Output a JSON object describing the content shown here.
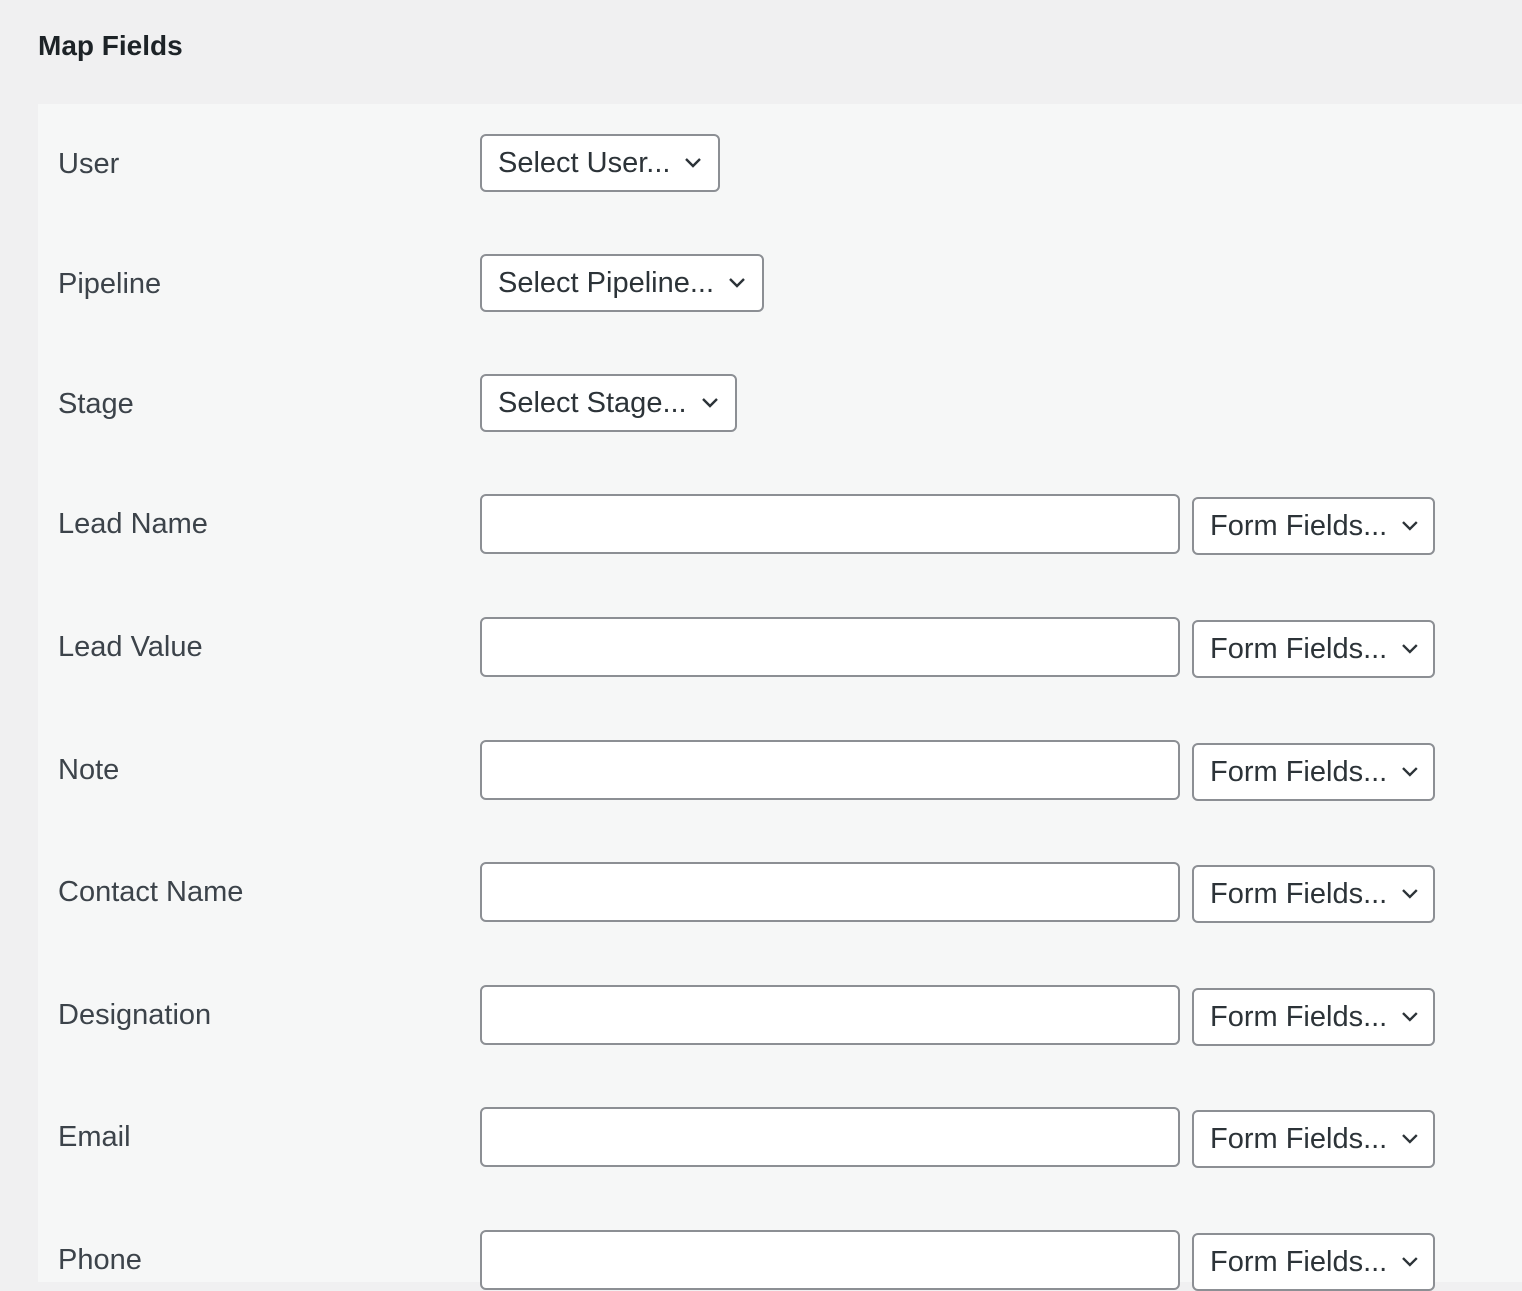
{
  "header": {
    "title": "Map Fields"
  },
  "top_selects": [
    {
      "label": "User",
      "placeholder": "Select User..."
    },
    {
      "label": "Pipeline",
      "placeholder": "Select Pipeline..."
    },
    {
      "label": "Stage",
      "placeholder": "Select Stage..."
    }
  ],
  "mapped_fields": [
    {
      "label": "Lead Name",
      "value": "",
      "select": "Form Fields..."
    },
    {
      "label": "Lead Value",
      "value": "",
      "select": "Form Fields..."
    },
    {
      "label": "Note",
      "value": "",
      "select": "Form Fields..."
    },
    {
      "label": "Contact Name",
      "value": "",
      "select": "Form Fields..."
    },
    {
      "label": "Designation",
      "value": "",
      "select": "Form Fields..."
    },
    {
      "label": "Email",
      "value": "",
      "select": "Form Fields..."
    },
    {
      "label": "Phone",
      "value": "",
      "select": "Form Fields..."
    }
  ],
  "icons": {
    "dropdown": "chevron-down-icon"
  },
  "colors": {
    "page_bg": "#f0f0f1",
    "panel_bg": "#f6f7f7",
    "border": "#8c8f94",
    "text": "#3c434a",
    "title": "#1d2327"
  }
}
